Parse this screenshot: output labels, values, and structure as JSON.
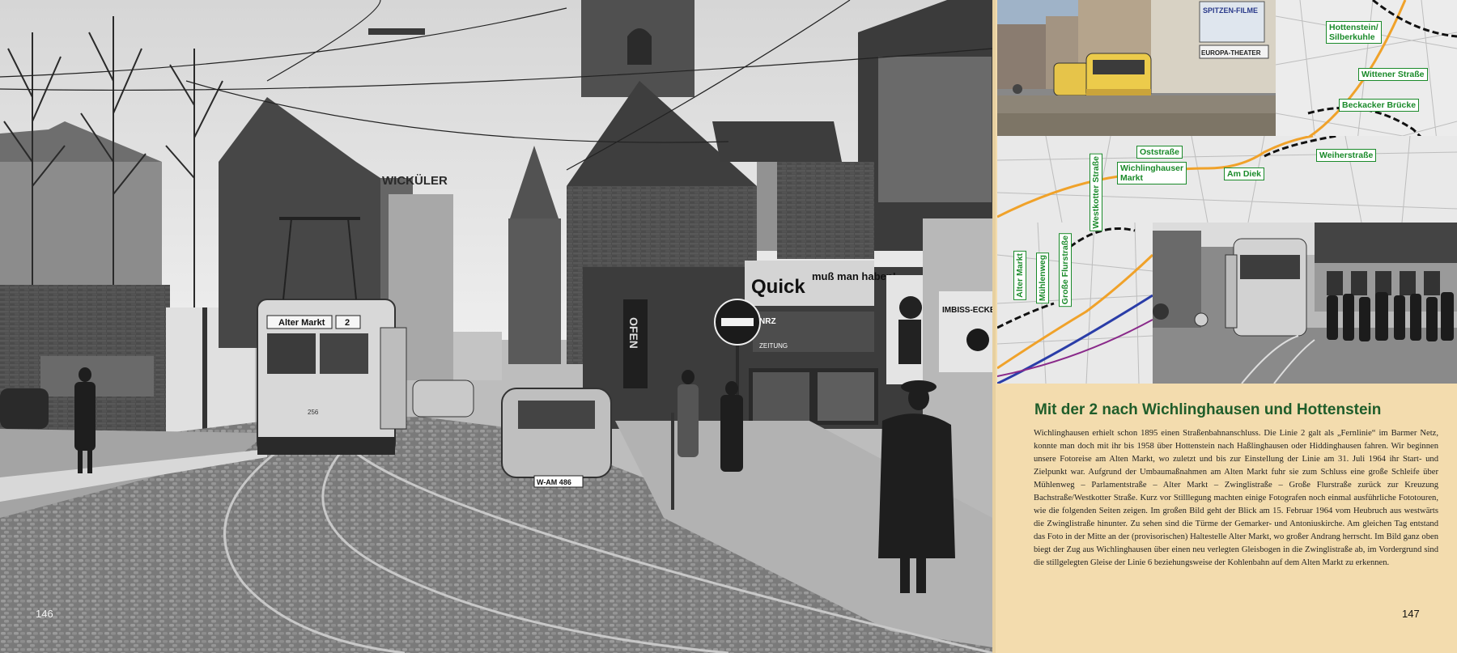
{
  "left_page": {
    "page_number": "146",
    "photo": {
      "sign_wickueler": "WICKÜLER",
      "tram_destination": "Alter Markt",
      "tram_line": "2",
      "tram_car_number": "256",
      "sign_quick": "Quick",
      "sign_muss_man_haben": "muß man haben!",
      "sign_ofen": "OFEN",
      "sign_imbiss": "IMBISS-ECKE",
      "sign_nrz": "NRZ",
      "sign_zeitung": "ZEITUNG",
      "license_plate": "W-AM 486"
    }
  },
  "right_page": {
    "page_number": "147",
    "top_photo": {
      "sign_spitzen_filme": "SPITZEN-FILME",
      "sign_europa_theater": "EUROPA-THEATER"
    },
    "map_labels": {
      "hottenstein": "Hottenstein/\nSilberkuhle",
      "wittener_strasse": "Wittener Straße",
      "beckacker_bruecke": "Beckacker Brücke",
      "weiherstrasse": "Weiherstraße",
      "oststrasse": "Oststraße",
      "wichlinghauser_markt": "Wichlinghauser\nMarkt",
      "am_diek": "Am Diek",
      "westkotter_strasse": "Westkotter Straße",
      "alter_markt": "Alter Markt",
      "muehlenweg": "Mühlenweg",
      "grosse_flurstrasse": "Große Flurstraße"
    },
    "headline": "Mit der 2 nach Wichlinghausen und Hottenstein",
    "body": "Wichlinghausen erhielt schon 1895 einen Straßenbahnanschluss. Die Linie 2 galt als „Fernlinie“ im Barmer Netz, konnte man doch mit ihr bis 1958 über Hottenstein nach Haßlinghausen oder Hiddinghausen fahren. Wir beginnen unsere Fotoreise am Alten Markt, wo zuletzt und bis zur Einstellung der Linie am 31. Juli 1964 ihr Start- und Zielpunkt war. Aufgrund der Umbaumaßnahmen am Alten Markt fuhr sie zum Schluss eine große Schleife über Mühlenweg – Parlamentstraße – Alter Markt – Zwinglistraße – Große Flurstraße zurück zur Kreuzung Bachstraße/Westkotter Straße. Kurz vor Stilllegung machten einige Fotografen noch einmal ausführliche Fototouren, wie die folgenden Seiten zeigen. Im großen Bild geht der Blick am 15. Februar 1964 vom Heubruch aus westwärts die Zwinglistraße hinunter. Zu sehen sind die Türme der Gemarker- und Antoniuskirche. Am gleichen Tag entstand das Foto in der Mitte an der (provisorischen) Haltestelle Alter Markt, wo großer Andrang herrscht. Im Bild ganz oben biegt der Zug aus Wichlinghausen über einen neu verlegten Gleisbogen in die Zwinglistraße ab, im Vordergrund sind die stillgelegten Gleise der Linie 6 beziehungsweise der Kohlenbahn auf dem Alten Markt zu erkennen."
  }
}
